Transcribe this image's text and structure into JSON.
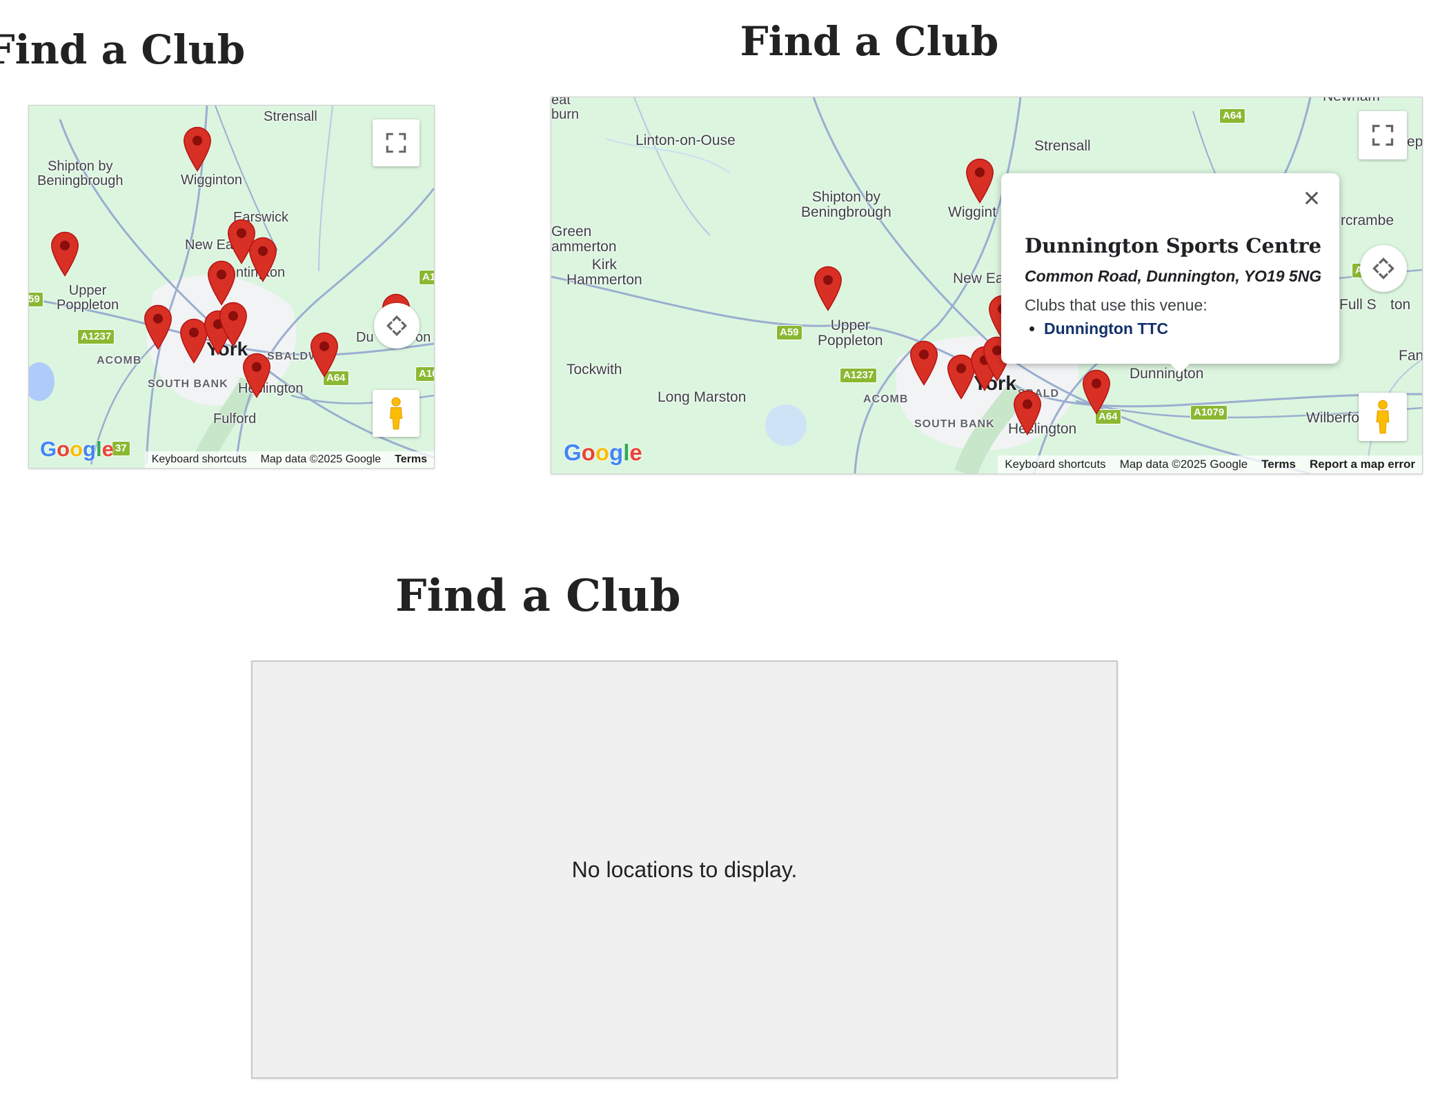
{
  "title": "Find a Club",
  "maps": {
    "small": {
      "labels": {
        "strensall": "Strensall",
        "shipton": "Shipton by\nBeningbrough",
        "wigginton": "Wigginton",
        "earswick": "Earswick",
        "new_earswick": "New Ea",
        "huntington": "ntington",
        "upper_poppleton": "Upper\nPoppleton",
        "york": "York",
        "acomb": "ACOMB",
        "osbaldwick": "SBALDW",
        "south_bank": "SOUTH BANK",
        "heslington": "Heslington",
        "fulford": "Fulford",
        "dunnington": "Du",
        "dunnington_tail": "on"
      },
      "shields": {
        "a1237": "A1237",
        "a64": "A64",
        "a59": "59",
        "a1": "A1",
        "a10": "A10",
        "a1237b": "37"
      }
    },
    "large": {
      "labels": {
        "eat_burn": "eat\nburn",
        "linton": "Linton-on-Ouse",
        "strensall": "Strensall",
        "shipton": "Shipton by\nBeningbrough",
        "wigginton": "Wiggint",
        "green_hammerton": "Green\nammerton",
        "kirk_hammerton": "Kirk\nHammerton",
        "new_earswick": "New Ea",
        "upper_poppleton": "Upper\nPoppleton",
        "tockwith": "Tockwith",
        "long_marston": "Long Marston",
        "acomb": "ACOMB",
        "york": "York",
        "osbaldwick": "SBALD",
        "south_bank": "SOUTH BANK",
        "heslington": "Heslington",
        "dunnington": "Dunnington",
        "wilberfoss": "Wilberfo",
        "full_sutton": "Full S",
        "sutton_tail": "ton",
        "stamford": "rcrambe",
        "fan": "Fan",
        "newham": "Newham",
        "ep": "ep"
      },
      "shields": {
        "a64_top": "A64",
        "a166": "A166",
        "a59": "A59",
        "a1237": "A1237",
        "a64": "A64",
        "a1079": "A1079"
      },
      "popup": {
        "venue": "Dunnington Sports Centre",
        "address": "Common Road, Dunnington, YO19 5NG",
        "uses_label": "Clubs that use this venue:",
        "clubs": [
          "Dunnington TTC"
        ]
      }
    }
  },
  "attribution": {
    "keyboard": "Keyboard shortcuts",
    "map_data": "Map data ©2025 Google",
    "terms": "Terms",
    "report": "Report a map error"
  },
  "google_logo": [
    "G",
    "o",
    "o",
    "g",
    "l",
    "e"
  ],
  "empty_message": "No locations to display.",
  "colors": {
    "map_bg": "#dcf5df",
    "pin": "#d93025",
    "road": "#9aaed0",
    "popup_link": "#13316b"
  },
  "icons": {
    "fullscreen": "fullscreen-icon",
    "camera": "camera-control-icon",
    "pegman": "pegman-icon",
    "close": "close-icon",
    "marker": "marker-icon"
  }
}
